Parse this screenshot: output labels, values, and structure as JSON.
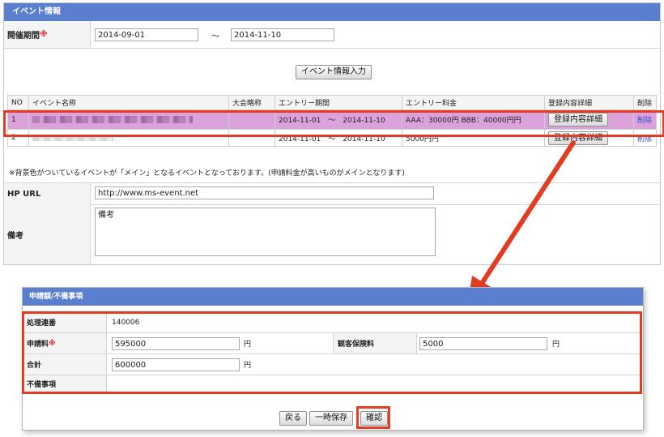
{
  "event_panel": {
    "title": "イベント情報",
    "period": {
      "label": "開催期間",
      "required_mark": "※",
      "start": "2014-09-01",
      "separator": "～",
      "end": "2014-11-10"
    },
    "input_button": "イベント情報入力",
    "table": {
      "headers": [
        "NO",
        "イベント名称",
        "大会略称",
        "エントリー期間",
        "エントリー料金",
        "登録内容詳細",
        "削除"
      ],
      "rows": [
        {
          "no": "1",
          "period": "2014-11-01　～　2014-11-10",
          "fee": "AAA：30000円 BBB：40000円円",
          "detail": "登録内容詳細",
          "delete": "削除"
        },
        {
          "no": "2",
          "period": "2014-11-01　～　2014-11-10",
          "fee": "5000円円",
          "detail": "登録内容詳細",
          "delete": "削除"
        }
      ]
    },
    "note": "※背景色がついているイベントが「メイン」となるイベントとなっております。(申請料金が高いものがメインとなります)",
    "hp_url": {
      "label": "HP URL",
      "value": "http://www.ms-event.net"
    },
    "remarks": {
      "label": "備考",
      "value": "備考"
    }
  },
  "fee_panel": {
    "title": "申請額/不備事項",
    "serial": {
      "label": "処理連番",
      "value": "140006"
    },
    "application_fee": {
      "label": "申請料",
      "required_mark": "※",
      "value": "595000",
      "unit": "円"
    },
    "insurance": {
      "label": "観客保険料",
      "value": "5000",
      "unit": "円"
    },
    "total": {
      "label": "合計",
      "value": "600000",
      "unit": "円"
    },
    "defects": {
      "label": "不備事項",
      "value": ""
    },
    "buttons": {
      "back": "戻る",
      "save": "一時保存",
      "confirm": "確認"
    }
  },
  "colors": {
    "header_blue": "#5b7fcf",
    "highlight_row": "#dca2dc",
    "callout_red": "#e23c22"
  }
}
